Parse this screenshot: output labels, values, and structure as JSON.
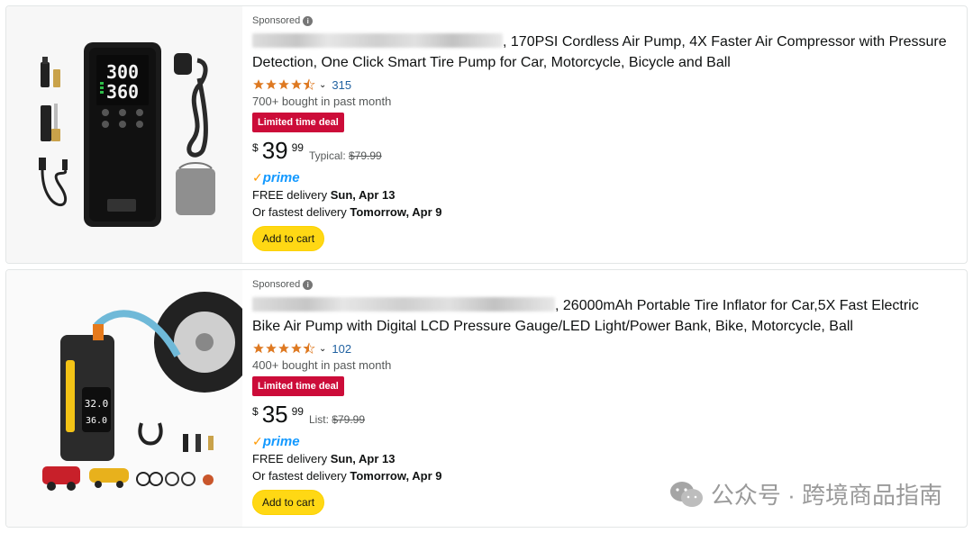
{
  "products": [
    {
      "sponsored": "Sponsored",
      "title_line1": ", 170PSI Cordless Air Pump, 4X Faster Air Compressor with Pressure",
      "title_line2": "Detection, One Click Smart Tire Pump for Car, Motorcycle, Bicycle and Ball",
      "rating": 4.5,
      "review_count": "315",
      "bought": "700+ bought in past month",
      "deal_badge": "Limited time deal",
      "price_symbol": "$",
      "price_whole": "39",
      "price_fraction": "99",
      "ref_label": "Typical:",
      "ref_price": "$79.99",
      "prime": "prime",
      "delivery_prefix": "FREE delivery",
      "delivery_date": "Sun, Apr 13",
      "fastest_prefix": "Or fastest delivery",
      "fastest_date": "Tomorrow, Apr 9",
      "cart_label": "Add to cart",
      "image_display_top": "300",
      "image_display_bottom": "360"
    },
    {
      "sponsored": "Sponsored",
      "title_line1": ", 26000mAh Portable Tire Inflator for Car,5X Fast Electric",
      "title_line2": "Bike Air Pump with Digital LCD Pressure Gauge/LED Light/Power Bank, Bike, Motorcycle, Ball",
      "rating": 4.5,
      "review_count": "102",
      "bought": "400+ bought in past month",
      "deal_badge": "Limited time deal",
      "price_symbol": "$",
      "price_whole": "35",
      "price_fraction": "99",
      "ref_label": "List:",
      "ref_price": "$79.99",
      "prime": "prime",
      "delivery_prefix": "FREE delivery",
      "delivery_date": "Sun, Apr 13",
      "fastest_prefix": "Or fastest delivery",
      "fastest_date": "Tomorrow, Apr 9",
      "cart_label": "Add to cart",
      "image_display_top": "32.0",
      "image_display_bottom": "36.0"
    }
  ],
  "watermark": "公众号 · 跨境商品指南",
  "colors": {
    "star": "#de7921",
    "deal": "#cc0c39",
    "link": "#2162a1",
    "prime": "#1399ff",
    "cart": "#ffd814"
  }
}
